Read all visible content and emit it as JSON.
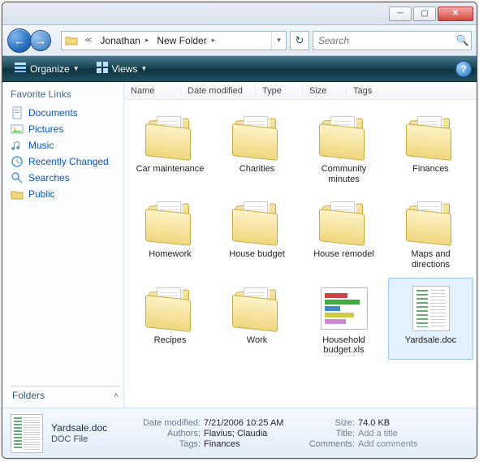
{
  "window": {
    "breadcrumb": [
      "Jonathan",
      "New Folder"
    ]
  },
  "search": {
    "placeholder": "Search"
  },
  "commandbar": {
    "organize": "Organize",
    "views": "Views"
  },
  "navpane": {
    "favorites_header": "Favorite Links",
    "links": [
      {
        "label": "Documents",
        "icon": "documents"
      },
      {
        "label": "Pictures",
        "icon": "pictures"
      },
      {
        "label": "Music",
        "icon": "music"
      },
      {
        "label": "Recently Changed",
        "icon": "recent"
      },
      {
        "label": "Searches",
        "icon": "searches"
      },
      {
        "label": "Public",
        "icon": "public"
      }
    ],
    "folders_label": "Folders"
  },
  "columns": [
    "Name",
    "Date modified",
    "Type",
    "Size",
    "Tags"
  ],
  "items": [
    {
      "name": "Car maintenance",
      "kind": "folder"
    },
    {
      "name": "Charities",
      "kind": "folder"
    },
    {
      "name": "Community minutes",
      "kind": "folder"
    },
    {
      "name": "Finances",
      "kind": "folder"
    },
    {
      "name": "Homework",
      "kind": "folder"
    },
    {
      "name": "House budget",
      "kind": "folder"
    },
    {
      "name": "House remodel",
      "kind": "folder"
    },
    {
      "name": "Maps and directions",
      "kind": "folder"
    },
    {
      "name": "Recipes",
      "kind": "folder"
    },
    {
      "name": "Work",
      "kind": "folder"
    },
    {
      "name": "Household budget.xls",
      "kind": "xls"
    },
    {
      "name": "Yardsale.doc",
      "kind": "doc",
      "selected": true
    }
  ],
  "details": {
    "filename": "Yardsale.doc",
    "filetype": "DOC File",
    "fields": {
      "date_modified_label": "Date modified:",
      "date_modified": "7/21/2006 10:25 AM",
      "authors_label": "Authors:",
      "authors": "Flavius; Claudia",
      "tags_label": "Tags:",
      "tags": "Finances",
      "size_label": "Size:",
      "size": "74.0 KB",
      "title_label": "Title:",
      "title": "Add a title",
      "comments_label": "Comments:",
      "comments": "Add comments"
    }
  }
}
